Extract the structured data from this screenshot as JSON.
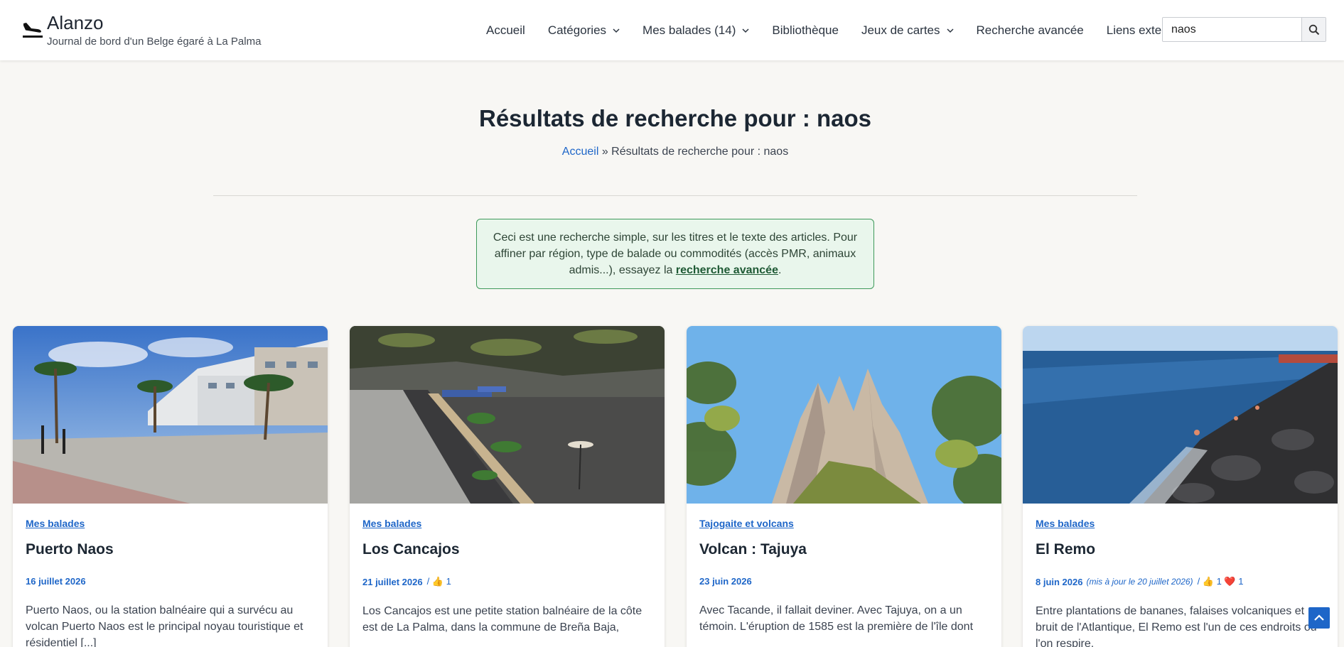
{
  "site": {
    "title": "Alanzo",
    "tagline": "Journal de bord d'un Belge égaré à La Palma"
  },
  "nav": {
    "items": [
      {
        "label": "Accueil",
        "dropdown": false
      },
      {
        "label": "Catégories",
        "dropdown": true
      },
      {
        "label": "Mes balades (14)",
        "dropdown": true
      },
      {
        "label": "Bibliothèque",
        "dropdown": false
      },
      {
        "label": "Jeux de cartes",
        "dropdown": true
      },
      {
        "label": "Recherche avancée",
        "dropdown": false
      },
      {
        "label": "Liens externes",
        "dropdown": true
      }
    ]
  },
  "search": {
    "value": "naos",
    "icon": "search-icon"
  },
  "page": {
    "title": "Résultats de recherche pour : naos",
    "breadcrumb_home": "Accueil",
    "breadcrumb_sep": " » ",
    "breadcrumb_current": "Résultats de recherche pour : naos"
  },
  "notice": {
    "text_before": "Ceci est une recherche simple, sur les titres et le texte des articles. Pour affiner par région, type de balade ou commodités (accès PMR, animaux admis...), essayez la ",
    "link": "recherche avancée",
    "text_after": "."
  },
  "cards": [
    {
      "category": "Mes balades",
      "title": "Puerto Naos",
      "date": "16 juillet 2026",
      "updated": "",
      "reactions": "",
      "excerpt": "Puerto Naos, ou la station balnéaire qui a survécu au volcan Puerto Naos est le principal noyau touristique et résidentiel [...]"
    },
    {
      "category": "Mes balades",
      "title": "Los Cancajos",
      "date": "21 juillet 2026",
      "updated": "",
      "reactions": "/ 👍 1",
      "excerpt": "Los Cancajos est une petite station balnéaire de la côte est de La Palma, dans la commune de Breña Baja,"
    },
    {
      "category": "Tajogaite et volcans",
      "title": "Volcan : Tajuya",
      "date": "23 juin 2026",
      "updated": "",
      "reactions": "",
      "excerpt": "Avec Tacande, il fallait deviner. Avec Tajuya, on a un témoin. L'éruption de 1585 est la première de l'île dont"
    },
    {
      "category": "Mes balades",
      "title": "El Remo",
      "date": "8 juin 2026",
      "updated": "(mis à jour le 20 juillet 2026)",
      "reactions": "/ 👍 1 ❤️ 1",
      "excerpt": "Entre plantations de bananes, falaises volcaniques et bruit de l'Atlantique, El Remo est l'un de ces endroits où l'on respire."
    }
  ],
  "colors": {
    "accent": "#1e66c8",
    "page_bg": "#f8f7f4",
    "notice_bg": "#e9f6ec",
    "notice_border": "#3f9a5b"
  }
}
